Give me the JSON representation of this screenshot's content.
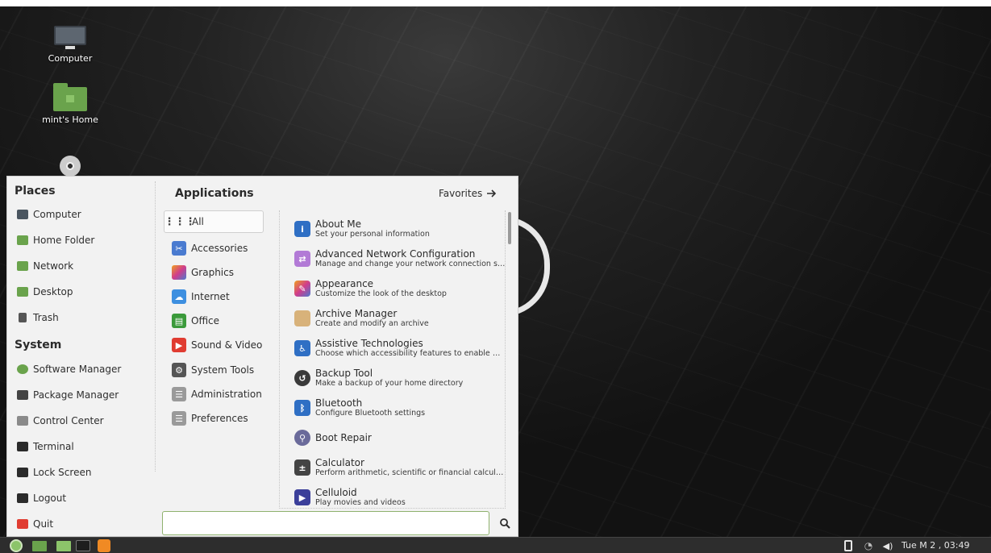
{
  "desktop": {
    "icons": [
      {
        "label": "Computer",
        "icon": "computer-icon"
      },
      {
        "label": "mint's Home",
        "icon": "home-folder-icon"
      },
      {
        "label": "",
        "icon": "disc-icon"
      }
    ]
  },
  "menu": {
    "places_title": "Places",
    "places": [
      {
        "label": "Computer",
        "icon": "computer-icon",
        "color": "#4a5560"
      },
      {
        "label": "Home Folder",
        "icon": "home-folder-icon",
        "color": "#6aa34c"
      },
      {
        "label": "Network",
        "icon": "network-folder-icon",
        "color": "#6aa34c"
      },
      {
        "label": "Desktop",
        "icon": "desktop-folder-icon",
        "color": "#6aa34c"
      },
      {
        "label": "Trash",
        "icon": "trash-icon",
        "color": "#555"
      }
    ],
    "system_title": "System",
    "system": [
      {
        "label": "Software Manager",
        "icon": "software-manager-icon",
        "color": "#6aa34c"
      },
      {
        "label": "Package Manager",
        "icon": "package-manager-icon",
        "color": "#444"
      },
      {
        "label": "Control Center",
        "icon": "control-center-icon",
        "color": "#6a6a6a"
      },
      {
        "label": "Terminal",
        "icon": "terminal-icon",
        "color": "#2b2b2b"
      },
      {
        "label": "Lock Screen",
        "icon": "lock-icon",
        "color": "#2b2b2b"
      },
      {
        "label": "Logout",
        "icon": "logout-icon",
        "color": "#2b2b2b"
      },
      {
        "label": "Quit",
        "icon": "power-icon",
        "color": "#e03c31"
      }
    ],
    "applications_title": "Applications",
    "favorites_label": "Favorites",
    "categories": [
      {
        "label": "All",
        "icon": "grid-icon",
        "selected": true
      },
      {
        "label": "Accessories",
        "icon": "accessories-icon",
        "color": "#4a7bd0"
      },
      {
        "label": "Graphics",
        "icon": "graphics-icon",
        "color": "#c84fbf"
      },
      {
        "label": "Internet",
        "icon": "internet-icon",
        "color": "#3d8fe0"
      },
      {
        "label": "Office",
        "icon": "office-icon",
        "color": "#3b9a3b"
      },
      {
        "label": "Sound & Video",
        "icon": "sound-video-icon",
        "color": "#e03c31"
      },
      {
        "label": "System Tools",
        "icon": "system-tools-icon",
        "color": "#555"
      },
      {
        "label": "Administration",
        "icon": "administration-icon",
        "color": "#8a8a8a"
      },
      {
        "label": "Preferences",
        "icon": "preferences-icon",
        "color": "#8a8a8a"
      }
    ],
    "apps": [
      {
        "name": "About Me",
        "desc": "Set your personal information",
        "icon": "about-me-icon",
        "color": "#2f6fc4",
        "glyph": "i"
      },
      {
        "name": "Advanced Network Configuration",
        "desc": "Manage and change your network connection settings",
        "icon": "network-config-icon",
        "color": "#b27ad6",
        "glyph": "⇄"
      },
      {
        "name": "Appearance",
        "desc": "Customize the look of the desktop",
        "icon": "appearance-icon",
        "color": "#e04d8a",
        "glyph": "✎"
      },
      {
        "name": "Archive Manager",
        "desc": "Create and modify an archive",
        "icon": "archive-manager-icon",
        "color": "#d8b27a",
        "glyph": ""
      },
      {
        "name": "Assistive Technologies",
        "desc": "Choose which accessibility features to enable when you log in",
        "icon": "accessibility-icon",
        "color": "#2f6fc4",
        "glyph": "♿"
      },
      {
        "name": "Backup Tool",
        "desc": "Make a backup of your home directory",
        "icon": "backup-icon",
        "color": "#3a3a3a",
        "glyph": "↺"
      },
      {
        "name": "Bluetooth",
        "desc": "Configure Bluetooth settings",
        "icon": "bluetooth-icon",
        "color": "#2f6fc4",
        "glyph": "ᛒ"
      },
      {
        "name": "Boot Repair",
        "desc": "",
        "icon": "boot-repair-icon",
        "color": "#6a6a9a",
        "glyph": "⚲"
      },
      {
        "name": "Calculator",
        "desc": "Perform arithmetic, scientific or financial calculations",
        "icon": "calculator-icon",
        "color": "#444",
        "glyph": "±"
      },
      {
        "name": "Celluloid",
        "desc": "Play movies and videos",
        "icon": "celluloid-icon",
        "color": "#3b3f9a",
        "glyph": "▶"
      }
    ],
    "search": {
      "placeholder": "",
      "value": ""
    }
  },
  "taskbar": {
    "clock": "Tue M  2 , 03:49",
    "launchers": [
      "mint-menu-icon",
      "show-desktop-icon",
      "files-icon",
      "terminal-icon",
      "update-manager-icon"
    ],
    "tray": [
      "battery-icon",
      "network-wireless-icon",
      "volume-icon"
    ]
  }
}
